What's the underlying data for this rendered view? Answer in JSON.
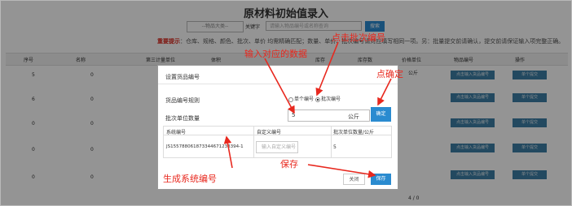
{
  "page": {
    "title": "原材料初始值录入",
    "filter_select": "--物品大类--",
    "keyword_label": "关键字",
    "keyword_placeholder": "请输入物品编号或名称查询",
    "search_label": "搜索",
    "hint_label": "重要提示",
    "hint_text": "：仓库、规格、颜色、批次、单价 均需精确匹配；数量、单价、批次编号请对应填写相同一项。另：批量提交前请确认，提交前请保证输入项完整正确。"
  },
  "table": {
    "headers": [
      "序号",
      "名称",
      "第三计量单位",
      "体积",
      "库存",
      "库存数",
      "价格单位",
      "物品编号",
      "操作"
    ],
    "rows": [
      {
        "seq": "5",
        "name": "0"
      },
      {
        "seq": "6",
        "name": "0"
      },
      {
        "seq": "0",
        "name": "0"
      },
      {
        "seq": "0",
        "name": "0"
      },
      {
        "seq": "0",
        "name": "0"
      }
    ],
    "unit_partial": "公斤",
    "btn_input_code": "点击输入货品编号",
    "btn_single": "单个提交",
    "tail_value": "4 / 0"
  },
  "modal": {
    "title": "设置货品编号",
    "rule_label": "货品编号规则",
    "radio_single": "单个编号",
    "radio_batch": "批次编号",
    "batch_qty_label": "批次单位数量",
    "batch_qty_value": "5",
    "unit": "公斤",
    "ok_label": "确定",
    "columns": [
      "系统编号",
      "自定义编号",
      "批次单位数量/公斤"
    ],
    "row": {
      "system_code": "JS155788061873344671233394-1",
      "custom_placeholder": "输入自定义编号",
      "qty": "5"
    },
    "close_label": "关闭",
    "save_label": "保存"
  },
  "annotations": {
    "input_data": "输入对应的数据",
    "click_batch": "点击批次编号",
    "click_ok": "点确定",
    "generate": "生成系统编号",
    "save": "保存"
  },
  "colors": {
    "annotation": "#e8281e",
    "primary_button": "#2a8bd0"
  }
}
